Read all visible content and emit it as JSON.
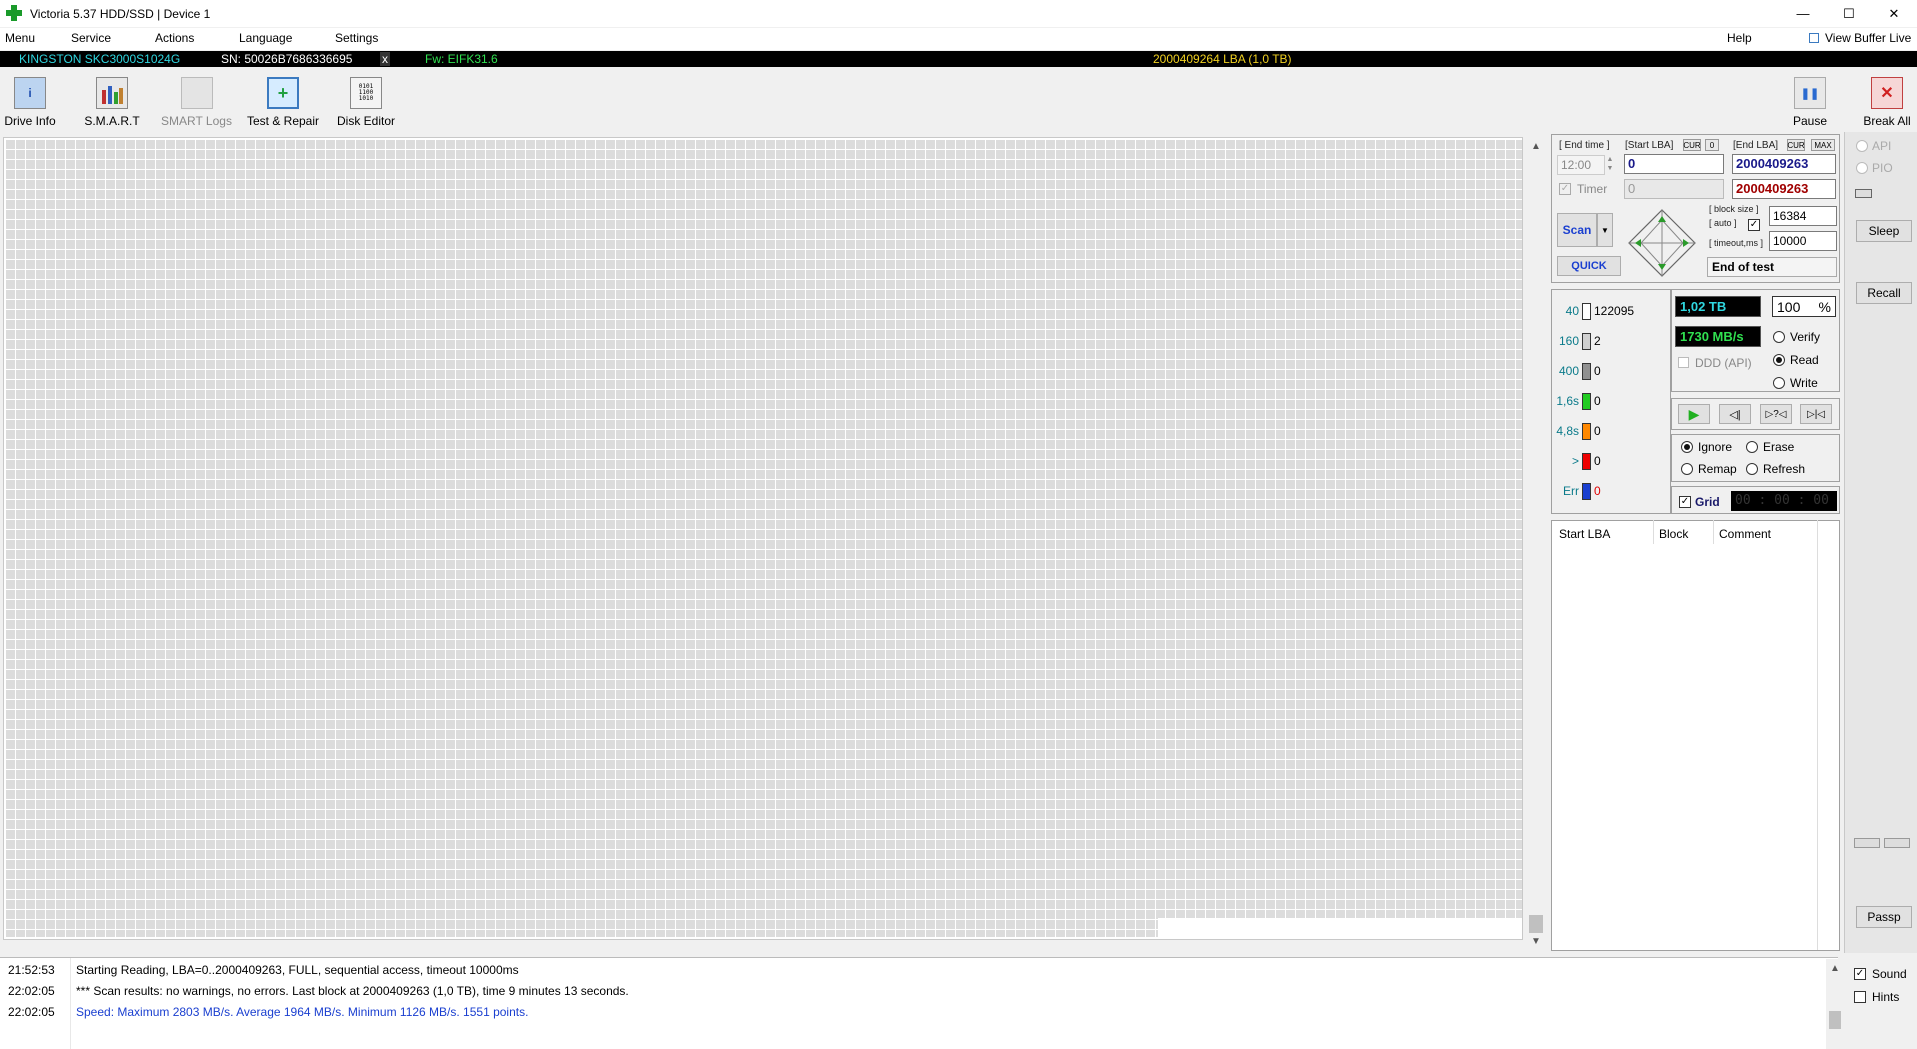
{
  "window": {
    "title": "Victoria 5.37 HDD/SSD | Device 1",
    "minimize": "—",
    "maximize": "☐",
    "close": "✕"
  },
  "menu": {
    "items": [
      "Menu",
      "Service",
      "Actions",
      "Language",
      "Settings"
    ],
    "help": "Help",
    "view_buffer": "View Buffer Live"
  },
  "device": {
    "model": "KINGSTON SKC3000S1024G",
    "serial": "SN: 50026B7686336695",
    "close_x": "x",
    "firmware": "Fw: EIFK31.6",
    "capacity": "2000409264 LBA (1,0 TB)"
  },
  "toolbar": {
    "drive_info": "Drive Info",
    "smart": "S.M.A.R.T",
    "smart_logs": "SMART Logs",
    "test_repair": "Test & Repair",
    "disk_editor": "Disk Editor",
    "pause": "Pause",
    "break_all": "Break All"
  },
  "scan": {
    "end_time_label": "[ End time ]",
    "end_time": "12:00",
    "timer_label": "Timer",
    "start_lba_label": "[Start LBA]",
    "cur_label": "CUR",
    "zero_label": "0",
    "start_lba": "0",
    "timer_value": "0",
    "end_lba_label": "[End LBA]",
    "max_label": "MAX",
    "end_lba": "2000409263",
    "end_lba2": "2000409263",
    "scan_button": "Scan",
    "quick_button": "QUICK",
    "block_size_label": "[ block size ]",
    "auto_label": "[ auto ]",
    "block_size": "16384",
    "timeout_label": "[ timeout,ms ]",
    "timeout": "10000",
    "end_action": "End of test"
  },
  "stats": [
    {
      "label": "40",
      "value": "122095",
      "color": "#ffffff"
    },
    {
      "label": "160",
      "value": "2",
      "color": "#d0d0d0"
    },
    {
      "label": "400",
      "value": "0",
      "color": "#909090"
    },
    {
      "label": "1,6s",
      "value": "0",
      "color": "#22cc22"
    },
    {
      "label": "4,8s",
      "value": "0",
      "color": "#ff8800"
    },
    {
      "label": ">",
      "value": "0",
      "color": "#ee0000"
    },
    {
      "label": "Err",
      "value": "0",
      "color": "#1a3fd0"
    }
  ],
  "progress": {
    "size": "1,02 TB",
    "percent": "100",
    "percent_sign": "%",
    "speed": "1730 MB/s",
    "ddd": "DDD (API)"
  },
  "mode": {
    "verify": "Verify",
    "read": "Read",
    "write": "Write"
  },
  "action": {
    "ignore": "Ignore",
    "erase": "Erase",
    "remap": "Remap",
    "refresh": "Refresh"
  },
  "grid_toggle": {
    "label": "Grid",
    "clock": "00 : 00 : 00"
  },
  "table": {
    "headers": [
      "Start LBA",
      "Block",
      "Comment"
    ]
  },
  "side": {
    "api": "API",
    "pio": "PIO",
    "sleep": "Sleep",
    "recall": "Recall",
    "passp": "Passp",
    "sound": "Sound",
    "hints": "Hints"
  },
  "log": [
    {
      "time": "21:52:53",
      "text": "Starting Reading, LBA=0..2000409263, FULL, sequential access, timeout 10000ms",
      "color": "#000000"
    },
    {
      "time": "22:02:05",
      "text": "*** Scan results: no warnings, no errors. Last block at 2000409263 (1,0 TB), time 9 minutes 13 seconds.",
      "color": "#000000"
    },
    {
      "time": "22:02:05",
      "text": "Speed: Maximum 2803 MB/s. Average 1964 MB/s. Minimum 1126 MB/s. 1551 points.",
      "color": "#1a3fd0"
    }
  ],
  "colors": {
    "cyan": "#2fd7e0",
    "green": "#30e050",
    "yellow": "#f0d020",
    "blue": "#1a3fd0",
    "darkred": "#a00000"
  }
}
